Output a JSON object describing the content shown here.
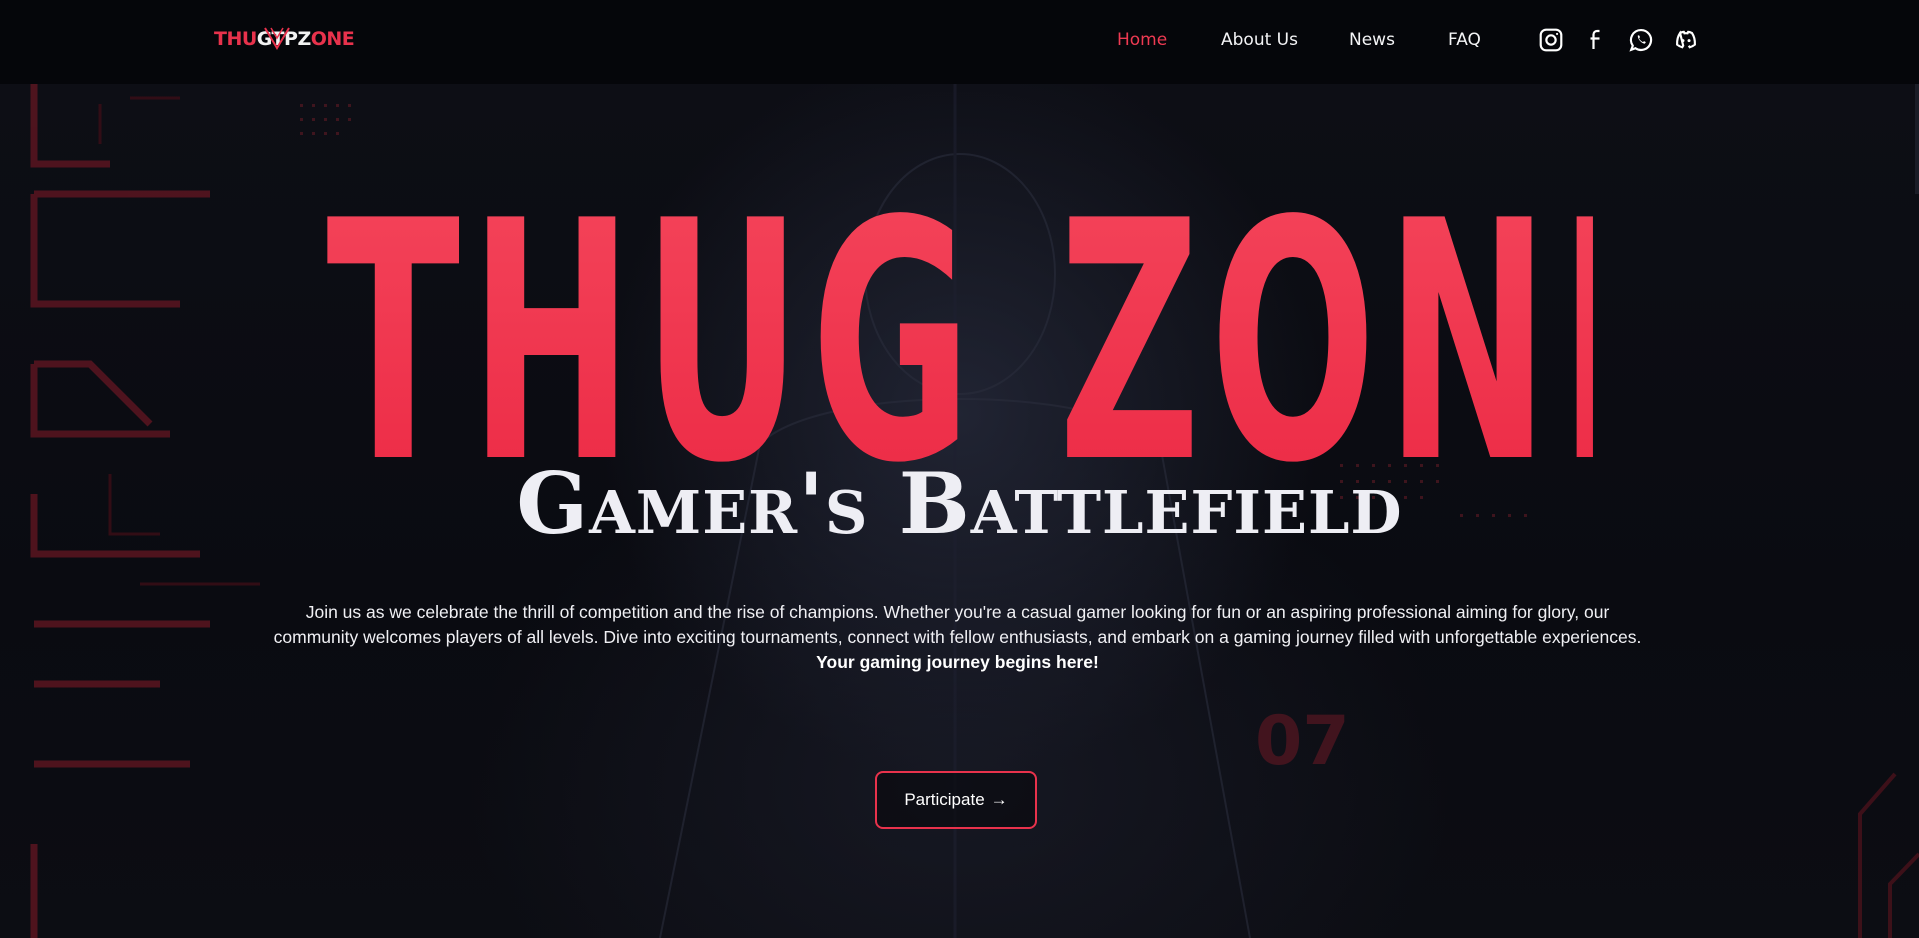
{
  "header": {
    "logo": {
      "part1": "THU",
      "part2": "GTPZ",
      "part3": "ONE"
    },
    "nav": [
      {
        "label": "Home",
        "active": true
      },
      {
        "label": "About Us",
        "active": false
      },
      {
        "label": "News",
        "active": false
      },
      {
        "label": "FAQ",
        "active": false
      }
    ],
    "social": [
      "instagram-icon",
      "facebook-icon",
      "whatsapp-icon",
      "discord-icon"
    ]
  },
  "hero": {
    "title": "THUG ZONE",
    "subtitle": "Gamer's Battlefield",
    "description": "Join us as we celebrate the thrill of competition and the rise of champions. Whether you're a casual gamer looking for fun or an aspiring professional aiming for glory, our community welcomes players of all levels. Dive into exciting tournaments, connect with fellow enthusiasts, and embark on a gaming journey filled with unforgettable experiences.",
    "description_emphasis": "Your gaming journey begins here!",
    "background_number": "07",
    "cta_label": "Participate",
    "cta_arrow": "→"
  },
  "colors": {
    "accent": "#ee3a52",
    "background": "#07080d",
    "text": "#f4f4f6"
  }
}
